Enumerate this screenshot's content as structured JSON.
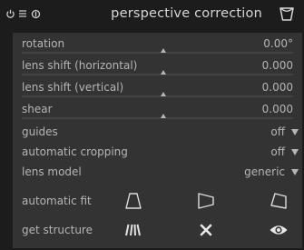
{
  "header": {
    "title": "perspective correction",
    "icons": [
      "power-icon",
      "menu-icon",
      "reset-icon",
      "presets-icon"
    ]
  },
  "sliders": [
    {
      "label": "rotation",
      "value": "0.00°",
      "position": 0.5
    },
    {
      "label": "lens shift (horizontal)",
      "value": "0.000",
      "position": 0.5
    },
    {
      "label": "lens shift (vertical)",
      "value": "0.000",
      "position": 0.5
    },
    {
      "label": "shear",
      "value": "0.000",
      "position": 0.5
    }
  ],
  "combos": [
    {
      "label": "guides",
      "value": "off"
    },
    {
      "label": "automatic cropping",
      "value": "off"
    },
    {
      "label": "lens model",
      "value": "generic"
    }
  ],
  "automatic_fit": {
    "label": "automatic fit",
    "buttons": [
      "fit-vertical-icon",
      "fit-horizontal-icon",
      "fit-both-icon"
    ]
  },
  "get_structure": {
    "label": "get structure",
    "buttons": [
      "detect-lines-icon",
      "clear-icon",
      "display-eye-icon"
    ]
  },
  "colors": {
    "background": "#1c1c1c",
    "panel": "#333333",
    "text": "#b5b5b5",
    "title": "#d6d6d6"
  }
}
